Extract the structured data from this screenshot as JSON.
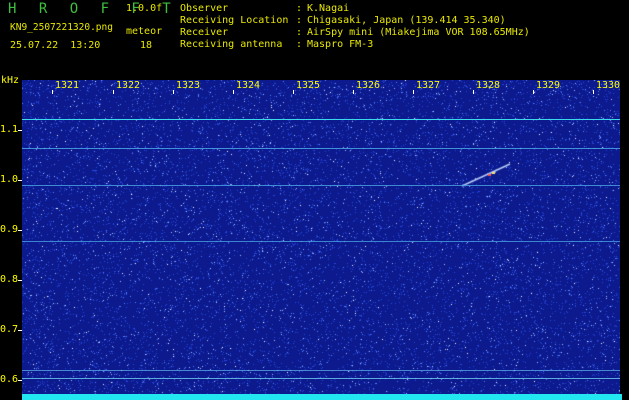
{
  "header": {
    "brand": "H R O F F T",
    "version": "1.0.0f",
    "filename": "KN9_2507221320.png",
    "meteor_label": "meteor",
    "datetime": "25.07.22  13:20",
    "meteor_count": "18",
    "info": [
      {
        "label": "Observer",
        "value": "K.Nagai"
      },
      {
        "label": "Receiving Location",
        "value": "Chigasaki, Japan (139.414 35.340)"
      },
      {
        "label": "Receiver",
        "value": "AirSpy mini (Miakejima VOR 108.65MHz)"
      },
      {
        "label": "Receiving antenna",
        "value": "Maspro FM-3"
      }
    ]
  },
  "spectrogram": {
    "y_unit": "kHz",
    "y_labels": [
      "1.1",
      "1.0",
      "0.9",
      "0.8",
      "0.7",
      "0.6"
    ],
    "x_labels": [
      "1321",
      "1322",
      "1323",
      "1324",
      "1325",
      "1326",
      "1327",
      "1328",
      "1329",
      "1330"
    ],
    "colors": {
      "background": "#0c1a8e",
      "noise": "#ffffff",
      "line": "#40e0ff",
      "bar": "#22e6f0",
      "text": "#ffff00"
    }
  }
}
